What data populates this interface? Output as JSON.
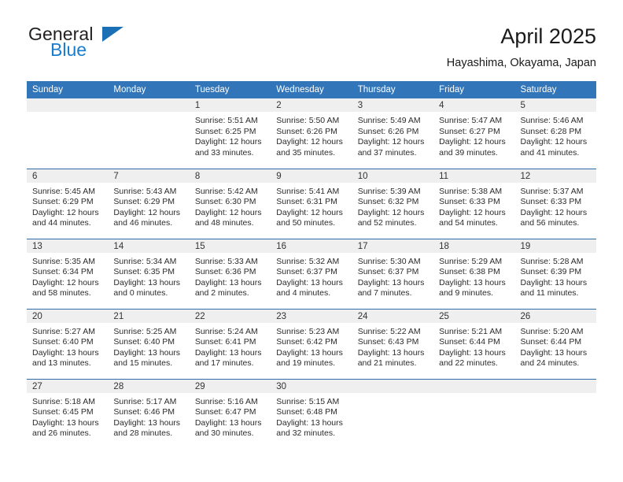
{
  "brand": {
    "name_part1": "General",
    "name_part2": "Blue",
    "accent_color": "#1a7ccc",
    "triangle_color": "#1a6fb5"
  },
  "header": {
    "title": "April 2025",
    "subtitle": "Hayashima, Okayama, Japan"
  },
  "theme": {
    "header_blue": "#3275b8",
    "row_divider_blue": "#2e6da8",
    "daynum_band": "#efefef"
  },
  "weekdays": [
    "Sunday",
    "Monday",
    "Tuesday",
    "Wednesday",
    "Thursday",
    "Friday",
    "Saturday"
  ],
  "weeks": [
    [
      {
        "day": "",
        "sunrise": "",
        "sunset": "",
        "daylight_a": "",
        "daylight_b": ""
      },
      {
        "day": "",
        "sunrise": "",
        "sunset": "",
        "daylight_a": "",
        "daylight_b": ""
      },
      {
        "day": "1",
        "sunrise": "Sunrise: 5:51 AM",
        "sunset": "Sunset: 6:25 PM",
        "daylight_a": "Daylight: 12 hours",
        "daylight_b": "and 33 minutes."
      },
      {
        "day": "2",
        "sunrise": "Sunrise: 5:50 AM",
        "sunset": "Sunset: 6:26 PM",
        "daylight_a": "Daylight: 12 hours",
        "daylight_b": "and 35 minutes."
      },
      {
        "day": "3",
        "sunrise": "Sunrise: 5:49 AM",
        "sunset": "Sunset: 6:26 PM",
        "daylight_a": "Daylight: 12 hours",
        "daylight_b": "and 37 minutes."
      },
      {
        "day": "4",
        "sunrise": "Sunrise: 5:47 AM",
        "sunset": "Sunset: 6:27 PM",
        "daylight_a": "Daylight: 12 hours",
        "daylight_b": "and 39 minutes."
      },
      {
        "day": "5",
        "sunrise": "Sunrise: 5:46 AM",
        "sunset": "Sunset: 6:28 PM",
        "daylight_a": "Daylight: 12 hours",
        "daylight_b": "and 41 minutes."
      }
    ],
    [
      {
        "day": "6",
        "sunrise": "Sunrise: 5:45 AM",
        "sunset": "Sunset: 6:29 PM",
        "daylight_a": "Daylight: 12 hours",
        "daylight_b": "and 44 minutes."
      },
      {
        "day": "7",
        "sunrise": "Sunrise: 5:43 AM",
        "sunset": "Sunset: 6:29 PM",
        "daylight_a": "Daylight: 12 hours",
        "daylight_b": "and 46 minutes."
      },
      {
        "day": "8",
        "sunrise": "Sunrise: 5:42 AM",
        "sunset": "Sunset: 6:30 PM",
        "daylight_a": "Daylight: 12 hours",
        "daylight_b": "and 48 minutes."
      },
      {
        "day": "9",
        "sunrise": "Sunrise: 5:41 AM",
        "sunset": "Sunset: 6:31 PM",
        "daylight_a": "Daylight: 12 hours",
        "daylight_b": "and 50 minutes."
      },
      {
        "day": "10",
        "sunrise": "Sunrise: 5:39 AM",
        "sunset": "Sunset: 6:32 PM",
        "daylight_a": "Daylight: 12 hours",
        "daylight_b": "and 52 minutes."
      },
      {
        "day": "11",
        "sunrise": "Sunrise: 5:38 AM",
        "sunset": "Sunset: 6:33 PM",
        "daylight_a": "Daylight: 12 hours",
        "daylight_b": "and 54 minutes."
      },
      {
        "day": "12",
        "sunrise": "Sunrise: 5:37 AM",
        "sunset": "Sunset: 6:33 PM",
        "daylight_a": "Daylight: 12 hours",
        "daylight_b": "and 56 minutes."
      }
    ],
    [
      {
        "day": "13",
        "sunrise": "Sunrise: 5:35 AM",
        "sunset": "Sunset: 6:34 PM",
        "daylight_a": "Daylight: 12 hours",
        "daylight_b": "and 58 minutes."
      },
      {
        "day": "14",
        "sunrise": "Sunrise: 5:34 AM",
        "sunset": "Sunset: 6:35 PM",
        "daylight_a": "Daylight: 13 hours",
        "daylight_b": "and 0 minutes."
      },
      {
        "day": "15",
        "sunrise": "Sunrise: 5:33 AM",
        "sunset": "Sunset: 6:36 PM",
        "daylight_a": "Daylight: 13 hours",
        "daylight_b": "and 2 minutes."
      },
      {
        "day": "16",
        "sunrise": "Sunrise: 5:32 AM",
        "sunset": "Sunset: 6:37 PM",
        "daylight_a": "Daylight: 13 hours",
        "daylight_b": "and 4 minutes."
      },
      {
        "day": "17",
        "sunrise": "Sunrise: 5:30 AM",
        "sunset": "Sunset: 6:37 PM",
        "daylight_a": "Daylight: 13 hours",
        "daylight_b": "and 7 minutes."
      },
      {
        "day": "18",
        "sunrise": "Sunrise: 5:29 AM",
        "sunset": "Sunset: 6:38 PM",
        "daylight_a": "Daylight: 13 hours",
        "daylight_b": "and 9 minutes."
      },
      {
        "day": "19",
        "sunrise": "Sunrise: 5:28 AM",
        "sunset": "Sunset: 6:39 PM",
        "daylight_a": "Daylight: 13 hours",
        "daylight_b": "and 11 minutes."
      }
    ],
    [
      {
        "day": "20",
        "sunrise": "Sunrise: 5:27 AM",
        "sunset": "Sunset: 6:40 PM",
        "daylight_a": "Daylight: 13 hours",
        "daylight_b": "and 13 minutes."
      },
      {
        "day": "21",
        "sunrise": "Sunrise: 5:25 AM",
        "sunset": "Sunset: 6:40 PM",
        "daylight_a": "Daylight: 13 hours",
        "daylight_b": "and 15 minutes."
      },
      {
        "day": "22",
        "sunrise": "Sunrise: 5:24 AM",
        "sunset": "Sunset: 6:41 PM",
        "daylight_a": "Daylight: 13 hours",
        "daylight_b": "and 17 minutes."
      },
      {
        "day": "23",
        "sunrise": "Sunrise: 5:23 AM",
        "sunset": "Sunset: 6:42 PM",
        "daylight_a": "Daylight: 13 hours",
        "daylight_b": "and 19 minutes."
      },
      {
        "day": "24",
        "sunrise": "Sunrise: 5:22 AM",
        "sunset": "Sunset: 6:43 PM",
        "daylight_a": "Daylight: 13 hours",
        "daylight_b": "and 21 minutes."
      },
      {
        "day": "25",
        "sunrise": "Sunrise: 5:21 AM",
        "sunset": "Sunset: 6:44 PM",
        "daylight_a": "Daylight: 13 hours",
        "daylight_b": "and 22 minutes."
      },
      {
        "day": "26",
        "sunrise": "Sunrise: 5:20 AM",
        "sunset": "Sunset: 6:44 PM",
        "daylight_a": "Daylight: 13 hours",
        "daylight_b": "and 24 minutes."
      }
    ],
    [
      {
        "day": "27",
        "sunrise": "Sunrise: 5:18 AM",
        "sunset": "Sunset: 6:45 PM",
        "daylight_a": "Daylight: 13 hours",
        "daylight_b": "and 26 minutes."
      },
      {
        "day": "28",
        "sunrise": "Sunrise: 5:17 AM",
        "sunset": "Sunset: 6:46 PM",
        "daylight_a": "Daylight: 13 hours",
        "daylight_b": "and 28 minutes."
      },
      {
        "day": "29",
        "sunrise": "Sunrise: 5:16 AM",
        "sunset": "Sunset: 6:47 PM",
        "daylight_a": "Daylight: 13 hours",
        "daylight_b": "and 30 minutes."
      },
      {
        "day": "30",
        "sunrise": "Sunrise: 5:15 AM",
        "sunset": "Sunset: 6:48 PM",
        "daylight_a": "Daylight: 13 hours",
        "daylight_b": "and 32 minutes."
      },
      {
        "day": "",
        "sunrise": "",
        "sunset": "",
        "daylight_a": "",
        "daylight_b": ""
      },
      {
        "day": "",
        "sunrise": "",
        "sunset": "",
        "daylight_a": "",
        "daylight_b": ""
      },
      {
        "day": "",
        "sunrise": "",
        "sunset": "",
        "daylight_a": "",
        "daylight_b": ""
      }
    ]
  ]
}
